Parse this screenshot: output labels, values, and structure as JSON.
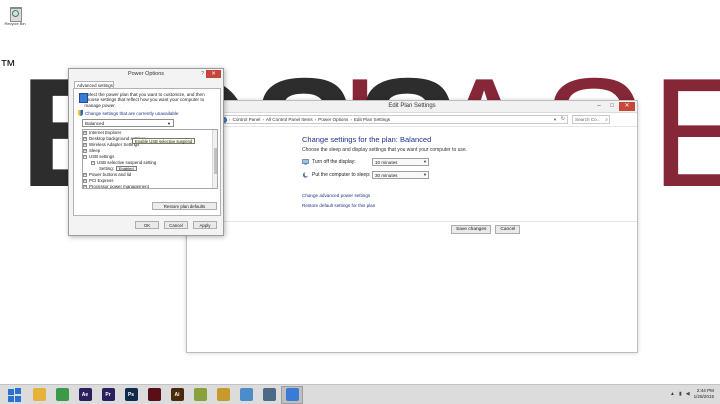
{
  "desktop": {
    "brand_mark": "™",
    "brand_color": "#7a1023",
    "recycle_bin_label": "Recycle Bin"
  },
  "edit_plan": {
    "window_title": "Edit Plan Settings",
    "address_path": [
      "Control Panel",
      "All Control Panel Items",
      "Power Options",
      "Edit Plan Settings"
    ],
    "search_placeholder": "Search Co...",
    "heading": "Change settings for the plan: Balanced",
    "subheading": "Choose the sleep and display settings that you want your computer to use.",
    "settings": [
      {
        "label": "Turn off the display:",
        "value": "10 minutes",
        "icon": "monitor-icon"
      },
      {
        "label": "Put the computer to sleep:",
        "value": "30 minutes",
        "icon": "moon-icon"
      }
    ],
    "links": {
      "advanced": "Change advanced power settings",
      "restore": "Restore default settings for this plan"
    },
    "buttons": {
      "save": "Save changes",
      "cancel": "Cancel"
    }
  },
  "power_options": {
    "window_title": "Power Options",
    "tab_label": "Advanced settings",
    "intro": "Select the power plan that you want to customize, and then choose settings that reflect how you want your computer to manage power.",
    "change_link": "Change settings that are currently unavailable",
    "plan_selected": "Balanced",
    "tree": [
      {
        "text": "Internet Explorer",
        "toggle": "+",
        "level": 0
      },
      {
        "text": "Desktop background settings",
        "toggle": "+",
        "level": 0
      },
      {
        "text": "Wireless Adapter Settings",
        "toggle": "+",
        "level": 0
      },
      {
        "text": "Sleep",
        "toggle": "+",
        "level": 0
      },
      {
        "text": "USB settings",
        "toggle": "−",
        "level": 0
      },
      {
        "text": "USB selective suspend setting",
        "toggle": "−",
        "level": 1
      },
      {
        "text": "Setting:",
        "toggle": "",
        "level": 2,
        "value": "Enabled"
      },
      {
        "text": "Power buttons and lid",
        "toggle": "+",
        "level": 0
      },
      {
        "text": "PCI Express",
        "toggle": "+",
        "level": 0
      },
      {
        "text": "Processor power management",
        "toggle": "+",
        "level": 0
      }
    ],
    "tooltip": "Enable USB selective suspend",
    "restore_button": "Restore plan defaults",
    "buttons": {
      "ok": "OK",
      "cancel": "Cancel",
      "apply": "Apply"
    }
  },
  "taskbar": {
    "apps": [
      {
        "name": "file-explorer-icon",
        "label": "",
        "color": "#e6b23a"
      },
      {
        "name": "chrome-icon",
        "label": "",
        "color": "#3a9a47"
      },
      {
        "name": "after-effects-icon",
        "label": "Ae",
        "color": "#2b1f5e"
      },
      {
        "name": "premiere-icon",
        "label": "Pr",
        "color": "#2b1f5e"
      },
      {
        "name": "photoshop-icon",
        "label": "Ps",
        "color": "#0f2a4a"
      },
      {
        "name": "media-app-icon",
        "label": "",
        "color": "#5a0e18"
      },
      {
        "name": "illustrator-icon",
        "label": "Ai",
        "color": "#4b2a0c"
      },
      {
        "name": "pen-app-icon",
        "label": "",
        "color": "#8aa03c"
      },
      {
        "name": "paint-app-icon",
        "label": "",
        "color": "#c89a2c"
      },
      {
        "name": "chat-app-icon",
        "label": "",
        "color": "#4a8dc9"
      },
      {
        "name": "image-app-icon",
        "label": "",
        "color": "#4c6a85"
      },
      {
        "name": "control-panel-icon",
        "label": "",
        "color": "#3a7bd5"
      }
    ],
    "time": "2:44 PM",
    "date": "1/28/2015"
  }
}
